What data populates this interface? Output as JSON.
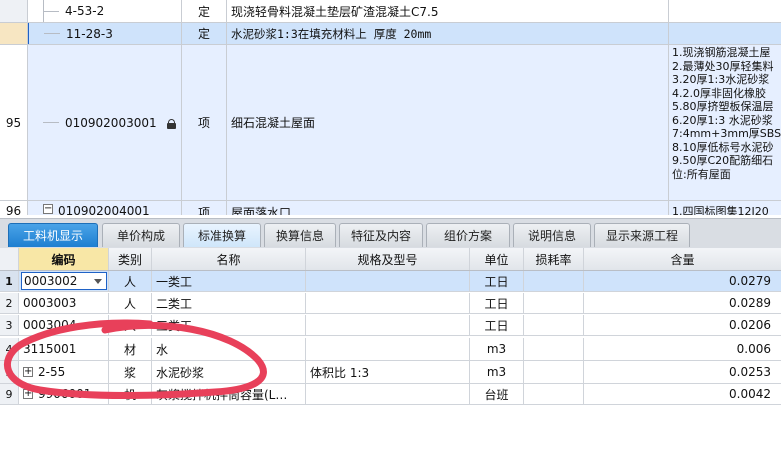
{
  "top_grid": {
    "rows": [
      {
        "num": "",
        "code": "4-53-2",
        "type": "定",
        "name": "现浇轻骨料混凝土垫层矿渣混凝土C7.5"
      },
      {
        "num": "",
        "code": "11-28-3",
        "type": "定",
        "name": "水泥砂浆1:3在填充材料上 厚度 20mm"
      },
      {
        "num": "95",
        "code": "010902003001",
        "type": "项",
        "name": "细石混凝土屋面",
        "features": [
          "1.现浇钢筋混凝土屋",
          "2.最薄处30厚轻集料",
          "3.20厚1:3水泥砂浆",
          "4.2.0厚非固化橡胶",
          "5.80厚挤塑板保温层",
          "6.20厚1:3 水泥砂浆",
          "7:4mm+3mm厚SBS 防",
          "8.10厚低标号水泥砂",
          "9.50厚C20配筋细石",
          "位:所有屋面"
        ]
      },
      {
        "num": "96",
        "code": "010902004001",
        "type": "项",
        "name": "屋面落水口",
        "features": [
          "1.四国标图集12J20"
        ]
      }
    ]
  },
  "tabs": [
    "工料机显示",
    "单价构成",
    "标准换算",
    "换算信息",
    "特征及内容",
    "组价方案",
    "说明信息",
    "显示来源工程"
  ],
  "bottom_grid": {
    "headers": {
      "code": "编码",
      "type": "类别",
      "name": "名称",
      "spec": "规格及型号",
      "unit": "单位",
      "loss": "损耗率",
      "qty": "含量"
    },
    "rows": [
      {
        "num": "1",
        "code": "0003002",
        "type": "人",
        "name": "一类工",
        "spec": "",
        "unit": "工日",
        "loss": "",
        "qty": "0.0279"
      },
      {
        "num": "2",
        "code": "0003003",
        "type": "人",
        "name": "二类工",
        "spec": "",
        "unit": "工日",
        "loss": "",
        "qty": "0.0289"
      },
      {
        "num": "3",
        "code": "0003004",
        "type": "人",
        "name": "三类工",
        "spec": "",
        "unit": "工日",
        "loss": "",
        "qty": "0.0206"
      },
      {
        "num": "4",
        "code": "3115001",
        "type": "材",
        "name": "水",
        "spec": "",
        "unit": "m3",
        "loss": "",
        "qty": "0.006"
      },
      {
        "num": "5",
        "code": "2-55",
        "type": "浆",
        "name": "水泥砂浆",
        "spec": "体积比 1:3",
        "unit": "m3",
        "loss": "",
        "qty": "0.0253"
      },
      {
        "num": "9",
        "code": "9906001",
        "type": "机",
        "name": "灰浆搅拌机拌筒容量(L…",
        "spec": "",
        "unit": "台班",
        "loss": "",
        "qty": "0.0042"
      }
    ]
  },
  "colors": {
    "active_tab": "#1d7fd1",
    "selected_row": "#cfe3fb",
    "annotation": "#e8405a"
  },
  "icons": {
    "lock": "lock-icon",
    "expand": "expand-icon",
    "dropdown": "chevron-down-icon"
  }
}
